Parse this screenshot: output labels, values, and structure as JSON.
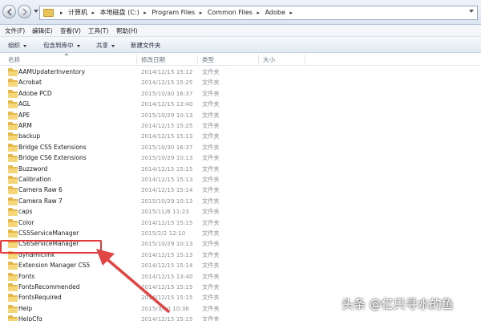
{
  "address": {
    "crumbs": [
      "计算机",
      "本地磁盘 (C:)",
      "Program Files",
      "Common Files",
      "Adobe"
    ]
  },
  "menu": [
    "文件(F)",
    "编辑(E)",
    "查看(V)",
    "工具(T)",
    "帮助(H)"
  ],
  "toolbar": {
    "organize": "组织",
    "include": "包含到库中",
    "share": "共享",
    "new_folder": "新建文件夹"
  },
  "columns": {
    "name": "名称",
    "date": "修改日期",
    "type": "类型",
    "size": "大小"
  },
  "files": [
    {
      "name": "AAMUpdaterInventory",
      "date": "2014/12/15 15:12",
      "type": "文件夹"
    },
    {
      "name": "Acrobat",
      "date": "2014/12/15 15:25",
      "type": "文件夹"
    },
    {
      "name": "Adobe PCD",
      "date": "2015/10/30 16:37",
      "type": "文件夹"
    },
    {
      "name": "AGL",
      "date": "2014/12/15 13:40",
      "type": "文件夹"
    },
    {
      "name": "APE",
      "date": "2015/10/29 10:13",
      "type": "文件夹"
    },
    {
      "name": "ARM",
      "date": "2014/12/15 15:25",
      "type": "文件夹"
    },
    {
      "name": "backup",
      "date": "2014/12/15 15:13",
      "type": "文件夹"
    },
    {
      "name": "Bridge CS5 Extensions",
      "date": "2015/10/30 16:37",
      "type": "文件夹"
    },
    {
      "name": "Bridge CS6 Extensions",
      "date": "2015/10/29 10:13",
      "type": "文件夹"
    },
    {
      "name": "Buzzword",
      "date": "2014/12/15 15:15",
      "type": "文件夹"
    },
    {
      "name": "Calibration",
      "date": "2014/12/15 15:13",
      "type": "文件夹"
    },
    {
      "name": "Camera Raw 6",
      "date": "2014/12/15 15:14",
      "type": "文件夹"
    },
    {
      "name": "Camera Raw 7",
      "date": "2015/10/29 10:13",
      "type": "文件夹"
    },
    {
      "name": "caps",
      "date": "2015/11/6 11:23",
      "type": "文件夹"
    },
    {
      "name": "Color",
      "date": "2014/12/15 15:15",
      "type": "文件夹"
    },
    {
      "name": "CS5ServiceManager",
      "date": "2015/2/2 12:10",
      "type": "文件夹"
    },
    {
      "name": "CS6ServiceManager",
      "date": "2015/10/29 10:13",
      "type": "文件夹"
    },
    {
      "name": "dynamiclink",
      "date": "2014/12/15 15:13",
      "type": "文件夹"
    },
    {
      "name": "Extension Manager CS5",
      "date": "2014/12/15 15:14",
      "type": "文件夹"
    },
    {
      "name": "Fonts",
      "date": "2014/12/15 13:40",
      "type": "文件夹"
    },
    {
      "name": "FontsRecommended",
      "date": "2014/12/15 15:15",
      "type": "文件夹"
    },
    {
      "name": "FontsRequired",
      "date": "2014/12/15 15:15",
      "type": "文件夹"
    },
    {
      "name": "Help",
      "date": "2015/3/10 10:36",
      "type": "文件夹"
    },
    {
      "name": "HelpCfg",
      "date": "2014/12/15 15:15",
      "type": "文件夹"
    }
  ],
  "watermark": "头条 @亿只寻水的鱼",
  "colors": {
    "folder": "#e4b84a",
    "highlight": "#e33b3b",
    "arrow": "#e04545"
  }
}
